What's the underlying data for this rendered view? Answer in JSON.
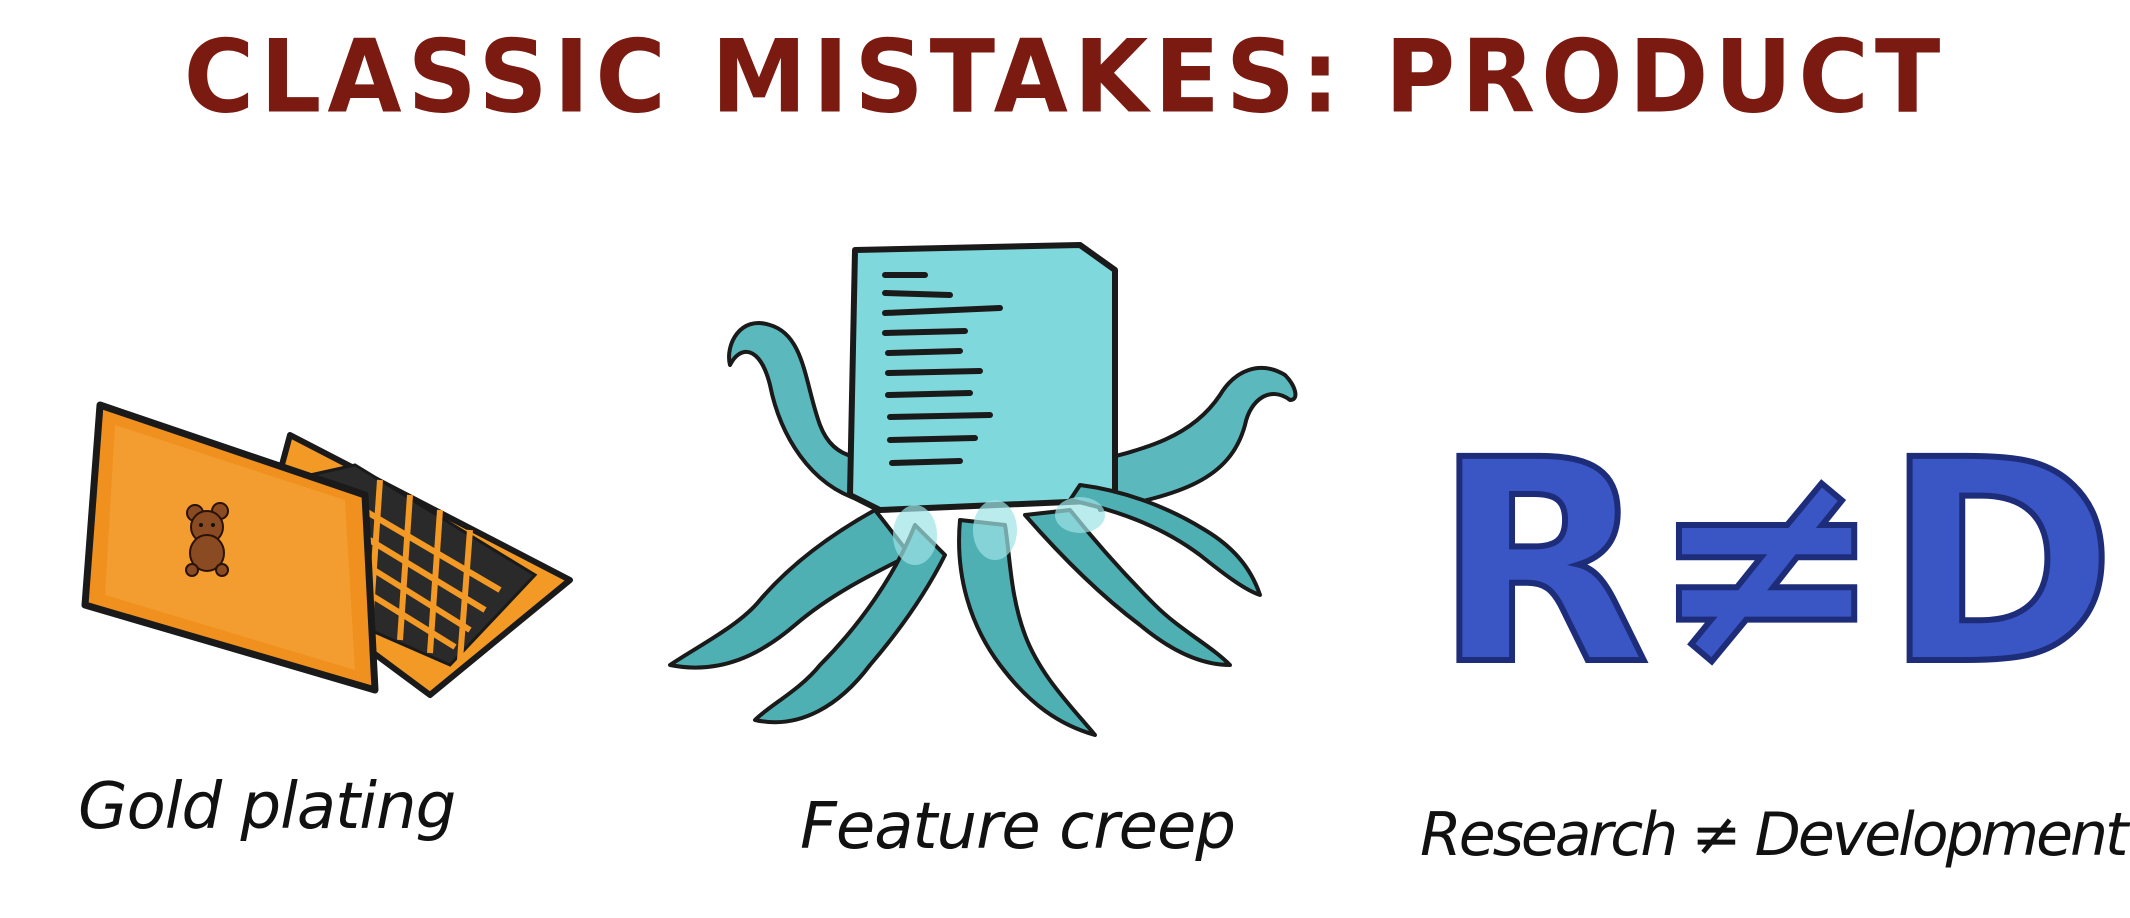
{
  "slide": {
    "title": "CLASSIC MISTAKES: PRODUCT",
    "items": [
      {
        "caption": "Gold plating",
        "icon": "laptop-with-teddy-bear-icon",
        "color": "#f0901e"
      },
      {
        "caption": "Feature creep",
        "icon": "document-octopus-icon",
        "color": "#4fb0b4"
      },
      {
        "caption": "Research ≠ Development",
        "icon": "r-not-equal-d-icon",
        "color": "#3a55c4",
        "glyph_text": "R≠D"
      }
    ]
  },
  "colors": {
    "title": "#7a1a10",
    "laptop": "#f0901e",
    "document": "#7fd9dc",
    "tentacles": "#4fb0b4",
    "rd_letters": "#3a55c4"
  }
}
